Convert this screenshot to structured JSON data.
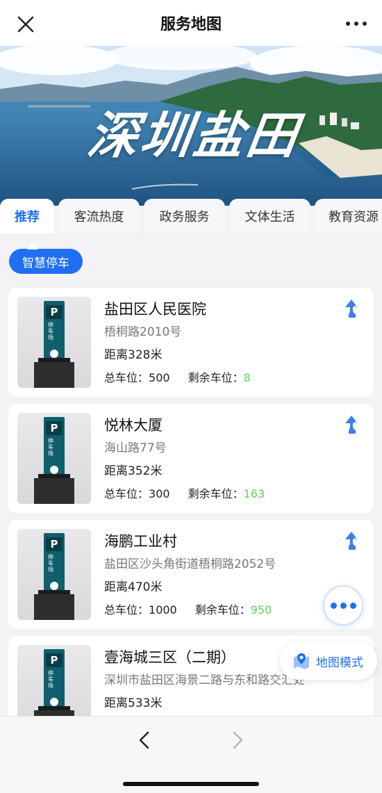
{
  "header": {
    "title": "服务地图"
  },
  "banner": {
    "text": "深圳盐田"
  },
  "tabs": [
    {
      "label": "推荐",
      "active": true
    },
    {
      "label": "客流热度",
      "active": false
    },
    {
      "label": "政务服务",
      "active": false
    },
    {
      "label": "文体生活",
      "active": false
    },
    {
      "label": "教育资源",
      "active": false
    }
  ],
  "chip": {
    "label": "智慧停车"
  },
  "parking": [
    {
      "name": "盐田区人民医院",
      "address": "梧桐路2010号",
      "distance": "距离328米",
      "total_label": "总车位：",
      "total": "500",
      "remain_label": "剩余车位：",
      "remain": "8"
    },
    {
      "name": "悦林大厦",
      "address": "海山路77号",
      "distance": "距离352米",
      "total_label": "总车位：",
      "total": "300",
      "remain_label": "剩余车位：",
      "remain": "163"
    },
    {
      "name": "海鹏工业村",
      "address": "盐田区沙头角街道梧桐路2052号",
      "distance": "距离470米",
      "total_label": "总车位：",
      "total": "1000",
      "remain_label": "剩余车位：",
      "remain": "950"
    },
    {
      "name": "壹海城三区（二期）",
      "address": "深圳市盐田区海景二路与东和路交汇处",
      "distance": "距离533米",
      "total_label": "",
      "total": "",
      "remain_label": "",
      "remain": ""
    }
  ],
  "thumb_sign": {
    "letter": "P",
    "text": "停车场"
  },
  "fab_map": {
    "label": "地图模式"
  },
  "colors": {
    "accent": "#1f6ff2",
    "remain_green": "#5fd15f"
  }
}
